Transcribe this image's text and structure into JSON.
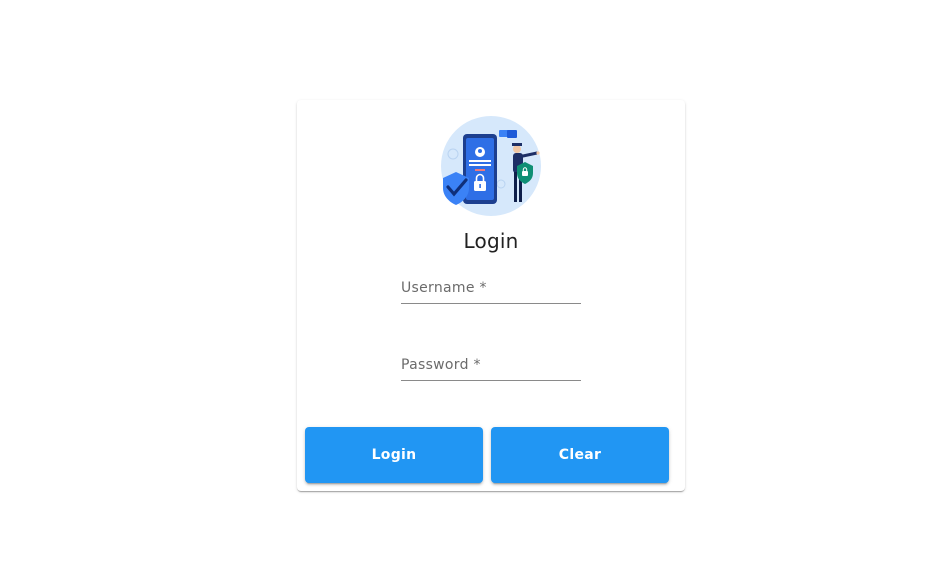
{
  "login_card": {
    "title": "Login",
    "illustration_icon": "security-login-illustration",
    "username": {
      "label": "Username *",
      "value": ""
    },
    "password": {
      "label": "Password *",
      "value": ""
    },
    "buttons": {
      "login_label": "Login",
      "clear_label": "Clear"
    }
  },
  "colors": {
    "primary_button": "#2196f3",
    "button_text": "#ffffff",
    "illustration_bg": "#d6e8fb",
    "card_background": "#ffffff"
  }
}
